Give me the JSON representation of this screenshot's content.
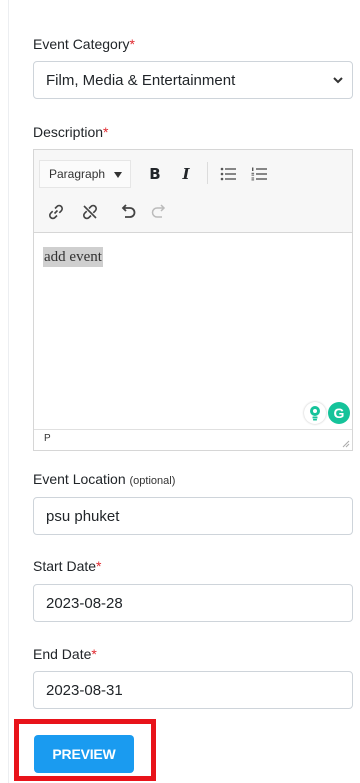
{
  "category": {
    "label": "Event Category",
    "required_mark": "*",
    "selected": "Film, Media & Entertainment"
  },
  "description": {
    "label": "Description",
    "required_mark": "*",
    "toolbar": {
      "paragraph_label": "Paragraph",
      "bold_label": "B",
      "italic_label": "I"
    },
    "content": "add event",
    "status_tag": "P",
    "grammarly_label": "G"
  },
  "location": {
    "label": "Event Location",
    "optional_note": "(optional)",
    "value": "psu phuket"
  },
  "start_date": {
    "label": "Start Date",
    "required_mark": "*",
    "value": "2023-08-28"
  },
  "end_date": {
    "label": "End Date",
    "required_mark": "*",
    "value": "2023-08-31"
  },
  "actions": {
    "preview_label": "PREVIEW"
  },
  "colors": {
    "required": "#e0282e",
    "primary_button": "#1a9bf0",
    "highlight": "#e8131a",
    "grammarly": "#15c39a"
  }
}
